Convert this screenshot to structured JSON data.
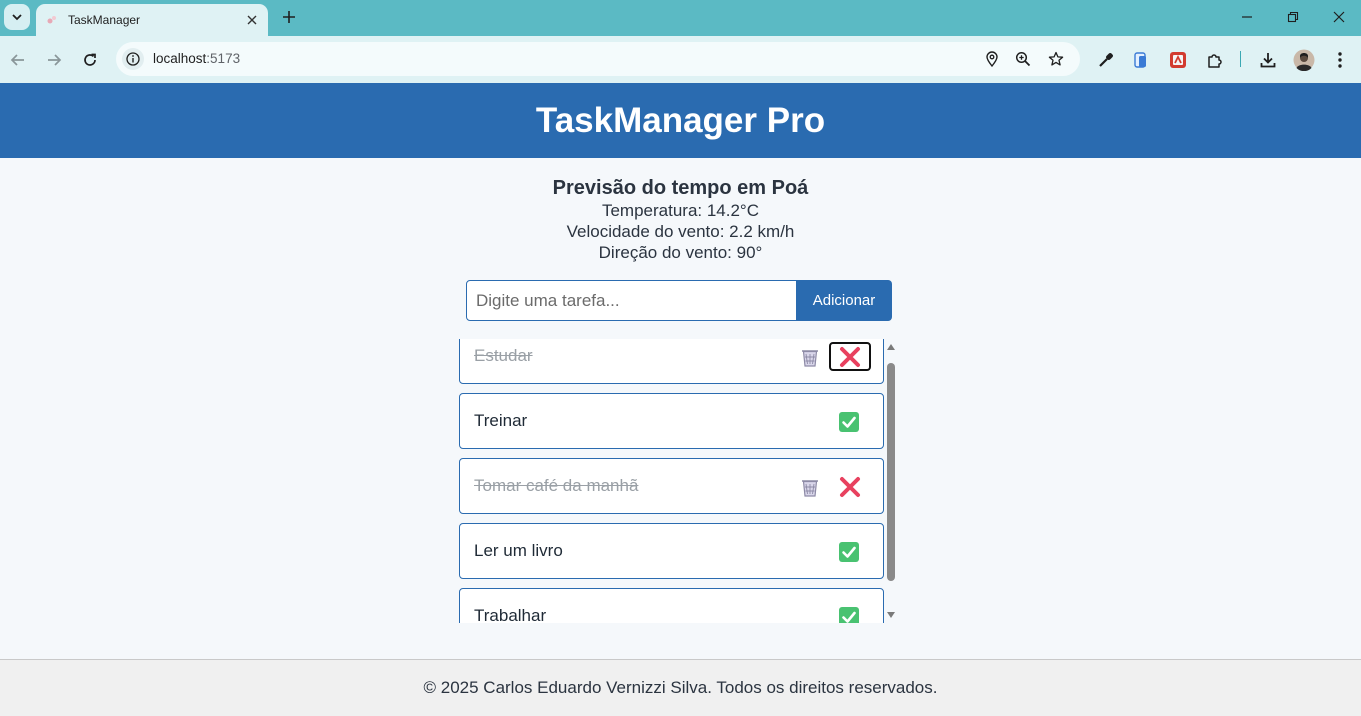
{
  "browser": {
    "tab_title": "TaskManager",
    "url_host": "localhost",
    "url_port": ":5173"
  },
  "app": {
    "title": "TaskManager Pro"
  },
  "weather": {
    "title": "Previsão do tempo em Poá",
    "temperature": "Temperatura: 14.2°C",
    "wind_speed": "Velocidade do vento: 2.2 km/h",
    "wind_direction": "Direção do vento: 90°"
  },
  "form": {
    "placeholder": "Digite uma tarefa...",
    "value": "",
    "add_label": "Adicionar"
  },
  "tasks": [
    {
      "text": "Estudar",
      "done": true
    },
    {
      "text": "Treinar",
      "done": false
    },
    {
      "text": "Tomar café da manhã",
      "done": true
    },
    {
      "text": "Ler um livro",
      "done": false
    },
    {
      "text": "Trabalhar",
      "done": false
    }
  ],
  "icons": {
    "complete": "check-mark-button-icon",
    "undo": "cross-mark-icon",
    "delete": "wastebasket-icon"
  },
  "colors": {
    "brand": "#2a6bb0",
    "check_green": "#49c271",
    "cross_red": "#e8415f"
  },
  "footer": {
    "text": "© 2025 Carlos Eduardo Vernizzi Silva. Todos os direitos reservados."
  }
}
